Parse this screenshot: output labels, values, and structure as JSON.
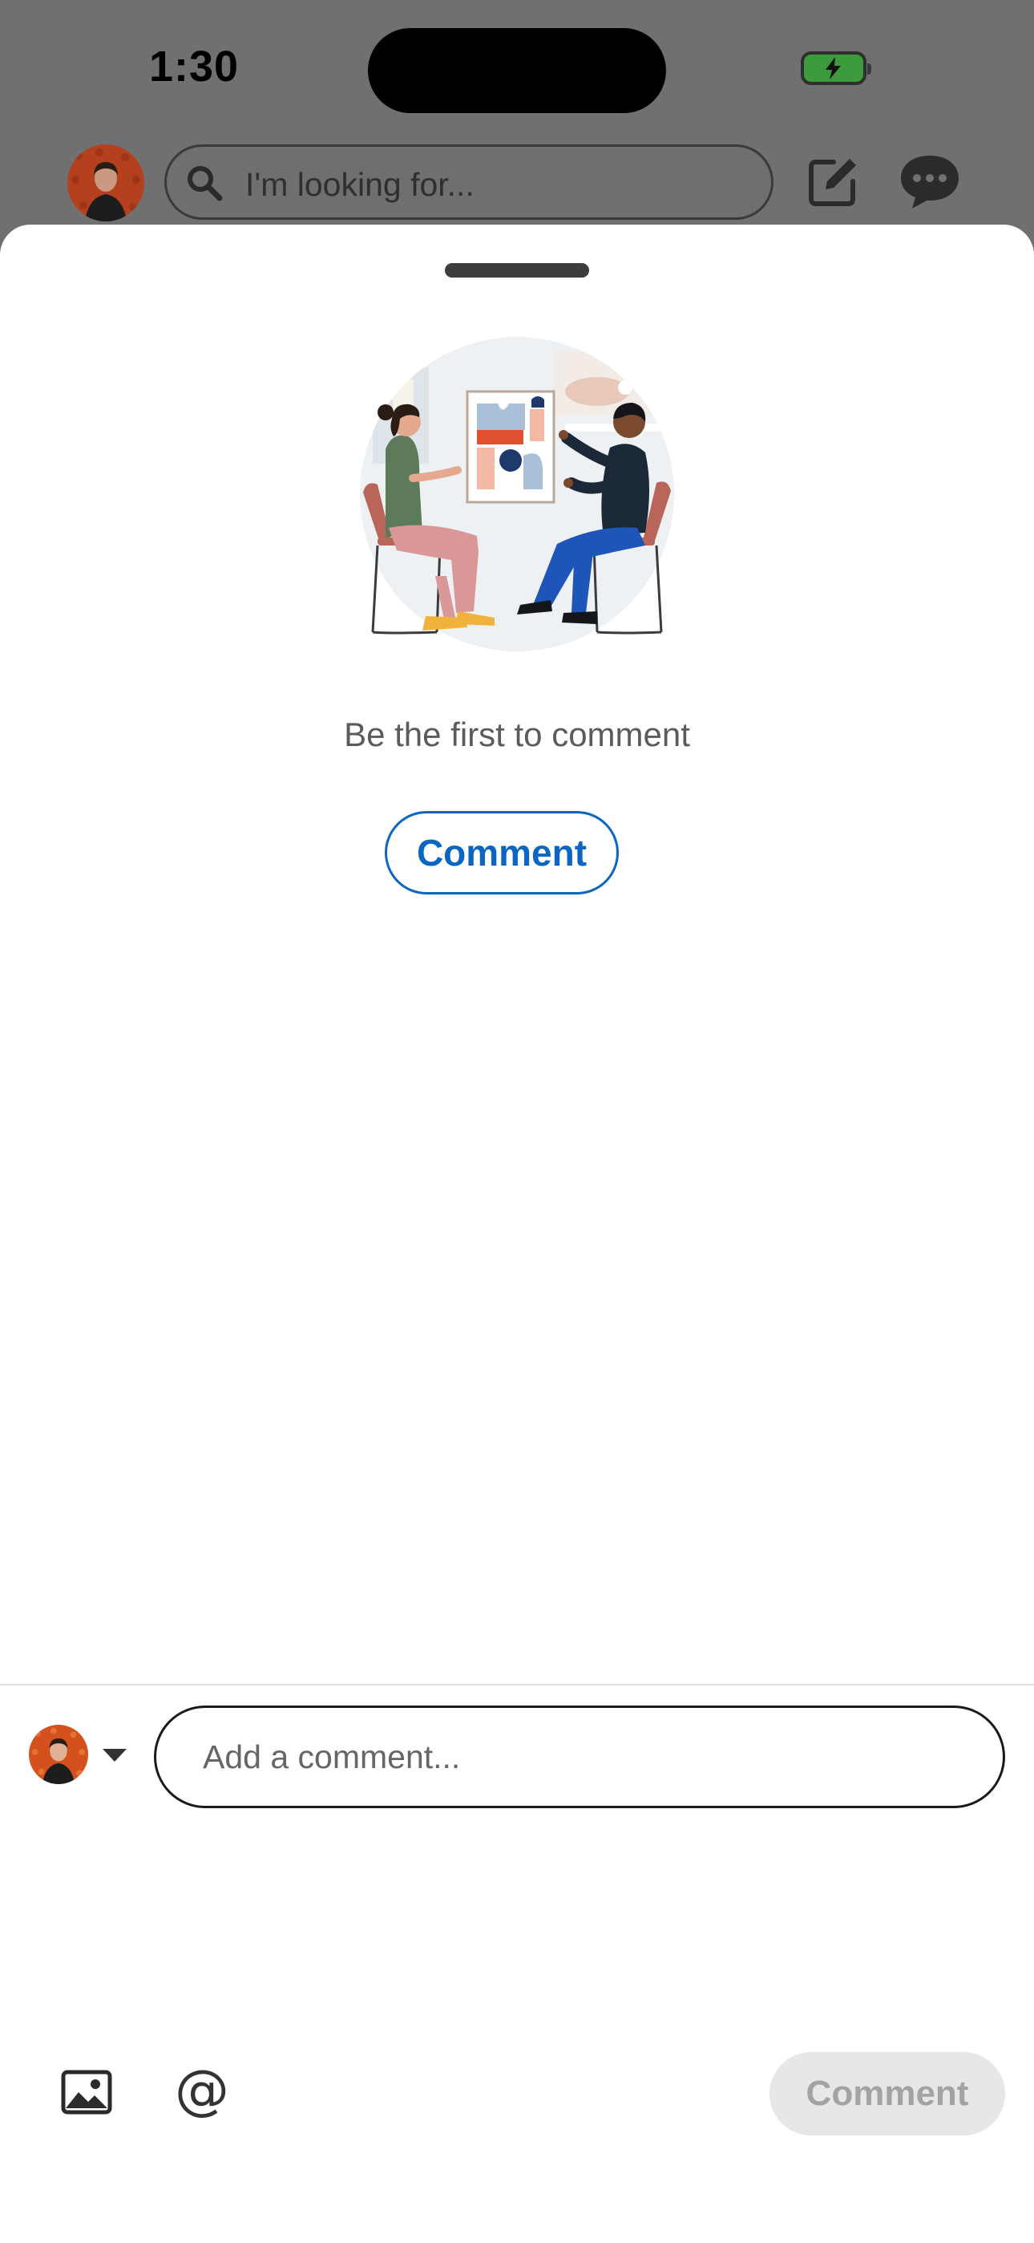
{
  "status_bar": {
    "time": "1:30"
  },
  "header": {
    "search_placeholder": "I'm looking for...",
    "icons": [
      "search-icon",
      "compose-icon",
      "messages-icon"
    ]
  },
  "sheet": {
    "empty_state_text": "Be the first to comment",
    "comment_button_label": "Comment"
  },
  "composer": {
    "input_placeholder": "Add a comment...",
    "submit_label": "Comment",
    "submit_enabled": false,
    "icons": [
      "image-icon",
      "mention-icon",
      "caret-down-icon"
    ]
  },
  "colors": {
    "accent": "#0a66c2",
    "backdrop": "#707070",
    "disabled_button_bg": "#e7e7e7",
    "disabled_button_text": "#a3a3a3"
  }
}
